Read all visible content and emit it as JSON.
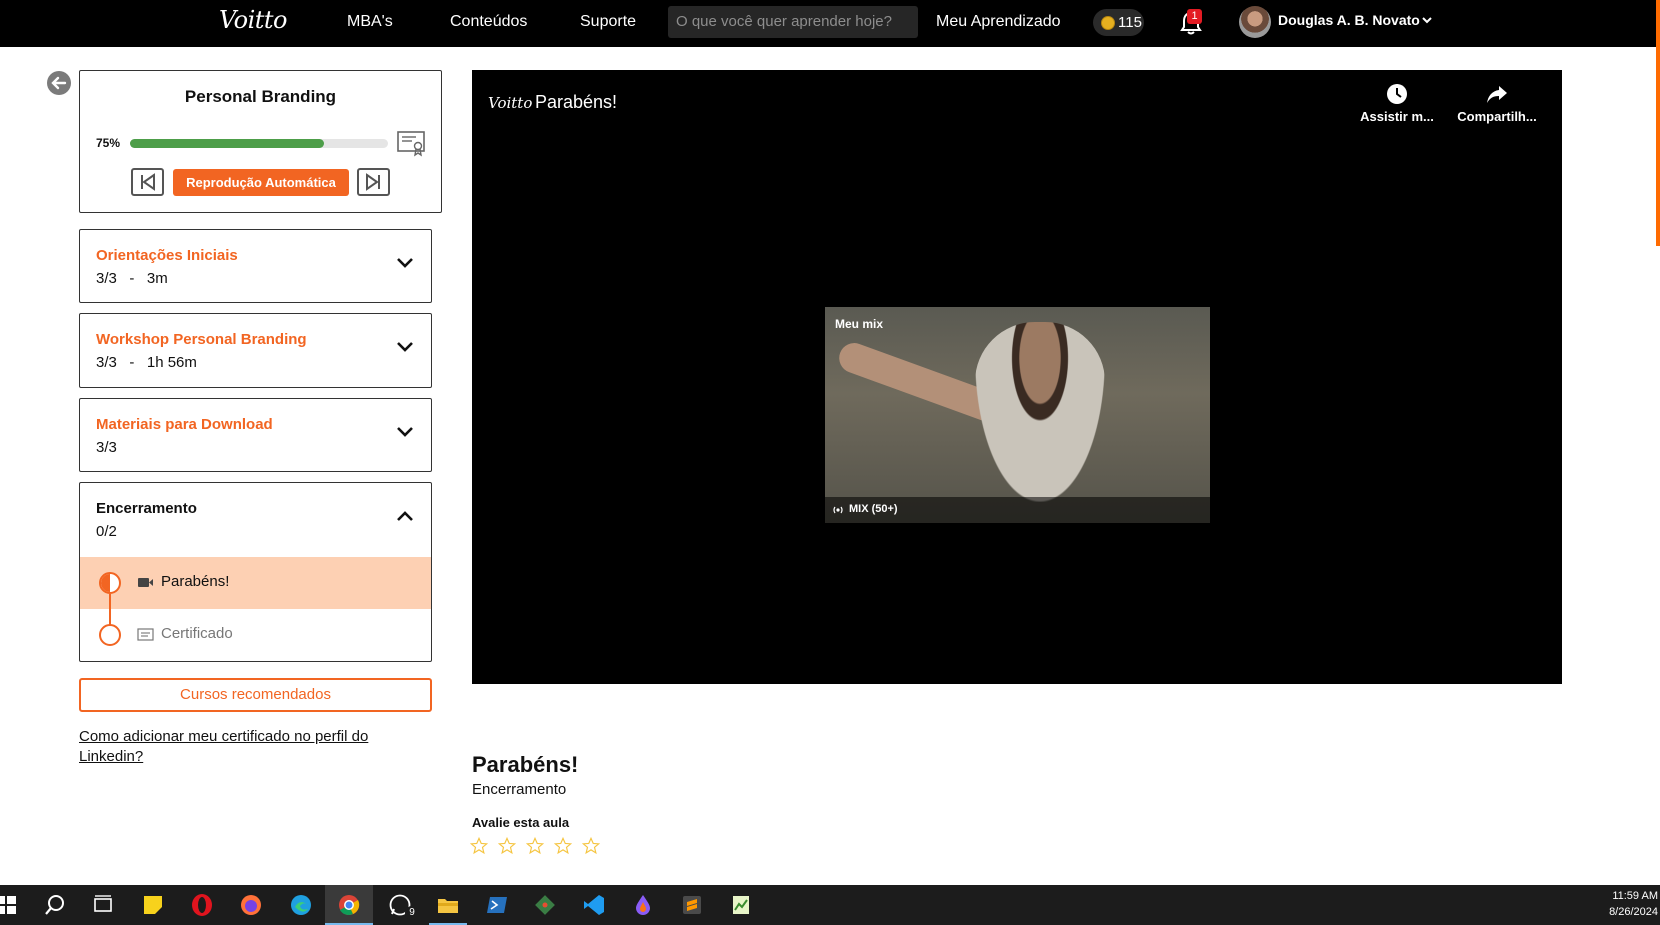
{
  "nav": {
    "logo": "Voitto",
    "links": [
      "MBA's",
      "Conteúdos",
      "Suporte"
    ],
    "search_placeholder": "O que você quer aprender hoje?",
    "my_learning": "Meu Aprendizado",
    "coins": "115",
    "notifications": "1",
    "user_name": "Douglas A. B. Novato"
  },
  "course": {
    "title": "Personal Branding",
    "progress_label": "75%",
    "progress_value": 0.75,
    "autoplay_label": "Reprodução Automática"
  },
  "sections": [
    {
      "title": "Orientações Iniciais",
      "sub": "3/3   -   3m"
    },
    {
      "title": "Workshop Personal Branding",
      "sub": "3/3   -   1h 56m"
    },
    {
      "title": "Materiais para Download",
      "sub": "3/3"
    },
    {
      "title": "Encerramento",
      "sub": "0/2"
    }
  ],
  "lessons": [
    {
      "label": "Parabéns!",
      "kind": "video-icon",
      "status": "in-progress"
    },
    {
      "label": "Certificado",
      "kind": "document-icon",
      "status": "not-started"
    }
  ],
  "recommended_label": "Cursos recomendados",
  "linkedin_help": "Como adicionar meu certificado no perfil do Linkedin?",
  "player": {
    "logo": "Voitto",
    "title": "Parabéns!",
    "watch_later": "Assistir m...",
    "share": "Compartilh...",
    "thumb_label": "Meu mix",
    "thumb_count": "MIX (50+)"
  },
  "lesson_info": {
    "heading": "Parabéns!",
    "section": "Encerramento",
    "rate_label": "Avalie esta aula",
    "stars": 5
  },
  "taskbar": {
    "time": "11:59 AM",
    "date": "8/26/2024",
    "whatsapp_badge": "9"
  },
  "colors": {
    "accent": "#f26522",
    "progress": "#4d9e49",
    "active_lesson_bg": "#fdd0b3"
  }
}
